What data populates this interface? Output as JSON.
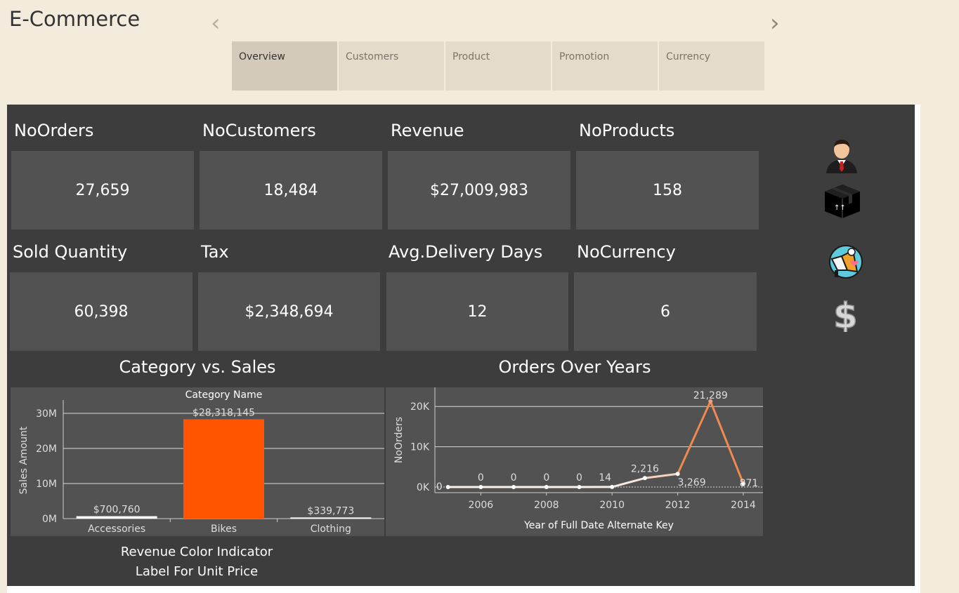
{
  "app": {
    "title": "E-Commerce"
  },
  "tabs": [
    {
      "label": "Overview",
      "active": true
    },
    {
      "label": "Customers",
      "active": false
    },
    {
      "label": "Product",
      "active": false
    },
    {
      "label": "Promotion",
      "active": false
    },
    {
      "label": "Currency",
      "active": false
    }
  ],
  "nav": {
    "prev_icon": "chevron-left-icon",
    "next_icon": "chevron-right-icon"
  },
  "kpis": [
    {
      "label": "NoOrders",
      "value": "27,659"
    },
    {
      "label": "NoCustomers",
      "value": "18,484"
    },
    {
      "label": "Revenue",
      "value": "$27,009,983"
    },
    {
      "label": "NoProducts",
      "value": "158"
    },
    {
      "label": "Sold Quantity",
      "value": "60,398"
    },
    {
      "label": "Tax",
      "value": "$2,348,694"
    },
    {
      "label": "Avg.Delivery Days",
      "value": "12"
    },
    {
      "label": "NoCurrency",
      "value": "6"
    }
  ],
  "side_icons": [
    "customer-avatar-icon",
    "product-box-icon",
    "promotion-megaphone-icon",
    "currency-dollar-icon"
  ],
  "colors": {
    "accent_orange": "#ff5500",
    "panel": "#525252",
    "background": "#3d3d3d"
  },
  "category_panel": {
    "title": "Category vs. Sales",
    "legend_line1": "Revenue Color Indicator",
    "legend_line2": "Label For Unit Price"
  },
  "orders_panel": {
    "title": "Orders Over Years"
  },
  "chart_data": [
    {
      "type": "bar",
      "title": "Category vs. Sales",
      "header": "Category Name",
      "categories": [
        "Accessories",
        "Bikes",
        "Clothing"
      ],
      "values": [
        700760,
        28318145,
        339773
      ],
      "value_labels": [
        "$700,760",
        "$28,318,145",
        "$339,773"
      ],
      "ylabel": "Sales Amount",
      "yticks": [
        "0M",
        "10M",
        "20M",
        "30M"
      ],
      "ylim": [
        0,
        33000000
      ],
      "grid": true
    },
    {
      "type": "line",
      "title": "Orders Over Years",
      "x": [
        2005,
        2006,
        2007,
        2008,
        2009,
        2010,
        2011,
        2012,
        2013,
        2014
      ],
      "values": [
        0,
        0,
        0,
        0,
        0,
        14,
        2216,
        3269,
        21289,
        871
      ],
      "point_labels": [
        "0",
        "0",
        "0",
        "0",
        "0",
        "14",
        "2,216",
        "3,269",
        "21,289",
        "871"
      ],
      "xlabel": "Year of Full Date Alternate Key",
      "ylabel": "NoOrders",
      "xticks": [
        "2006",
        "2008",
        "2010",
        "2012",
        "2014"
      ],
      "yticks": [
        "0K",
        "10K",
        "20K"
      ],
      "ylim": [
        0,
        23000
      ],
      "grid": true
    }
  ]
}
